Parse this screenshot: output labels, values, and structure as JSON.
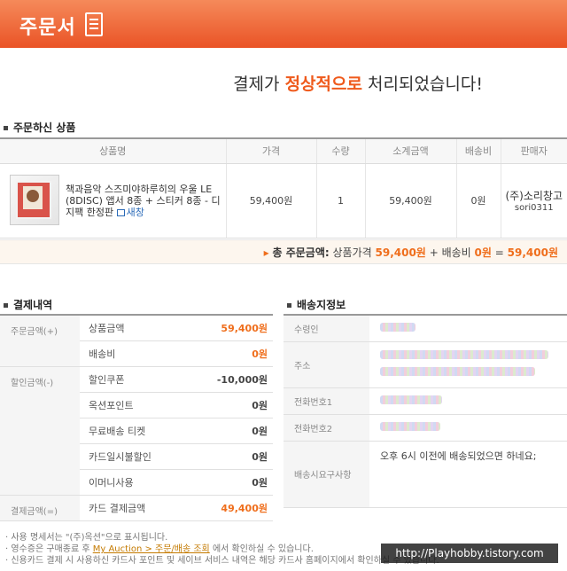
{
  "header": {
    "title": "주문서",
    "icon": "document-icon"
  },
  "message": {
    "before": "결제가",
    "emphasis": "정상적으로",
    "after": "처리되었습니다!"
  },
  "products": {
    "section_title": "주문하신 상품",
    "columns": [
      "상품명",
      "가격",
      "수량",
      "소계금액",
      "배송비",
      "판매자"
    ],
    "items": [
      {
        "name": "책과음악 스즈미야하루히의 우울 LE (8DISC) 앱서 8종 + 스티커 8종 - 디지팩 한정판",
        "detail_label": "새창",
        "price": "59,400원",
        "qty": "1",
        "subtotal": "59,400원",
        "shipping": "0원",
        "seller_name": "(주)소리창고",
        "seller_id": "sori0311"
      }
    ]
  },
  "total": {
    "label": "총 주문금액:",
    "goods_label": "상품가격",
    "goods_value": "59,400원",
    "plus": "+",
    "shipping_label": "배송비",
    "shipping_value": "0원",
    "equals": "=",
    "final": "59,400원"
  },
  "payment": {
    "section_title": "결제내역",
    "groups": [
      {
        "label": "주문금액(+)",
        "rows": [
          {
            "label": "상품금액",
            "value": "59,400원",
            "accent": true
          },
          {
            "label": "배송비",
            "value": "0원",
            "accent": true
          }
        ]
      },
      {
        "label": "할인금액(-)",
        "rows": [
          {
            "label": "할인쿠폰",
            "value": "-10,000원",
            "accent": false
          },
          {
            "label": "옥션포인트",
            "value": "0원",
            "accent": false
          },
          {
            "label": "무료배송 티켓",
            "value": "0원",
            "accent": false
          },
          {
            "label": "카드일시불할인",
            "value": "0원",
            "accent": false
          },
          {
            "label": "이머니사용",
            "value": "0원",
            "accent": false
          }
        ]
      },
      {
        "label": "결제금액(=)",
        "rows": [
          {
            "label": "카드 결제금액",
            "value": "49,400원",
            "accent": true
          }
        ]
      }
    ]
  },
  "shipping": {
    "section_title": "배송지정보",
    "rows": [
      {
        "label": "수령인",
        "value": ""
      },
      {
        "label": "주소",
        "value": ""
      },
      {
        "label": "전화번호1",
        "value": ""
      },
      {
        "label": "전화번호2",
        "value": ""
      },
      {
        "label": "배송시요구사항",
        "value": "오후 6시 이전에 배송되었으면 하네요;"
      }
    ]
  },
  "notes": {
    "line1": "사용 명세서는 \"(주)옥션\"으로 표시됩니다.",
    "line2_before": "영수증은 구매종료 후",
    "line2_link": "My Auction > 주문/배송 조회",
    "line2_after": "에서 확인하실 수 있습니다.",
    "line3": "신용카드 결제 시 사용하신 카드사 포인트 및 세이브 서비스 내역은 해당 카드사 홈페이지에서 확인하실 수 있습니다."
  },
  "watermark": "http://Playhobby.tistory.com",
  "colors": {
    "header": "#ea5326",
    "accent": "#ef6e1c",
    "link": "#2a6ab8"
  }
}
